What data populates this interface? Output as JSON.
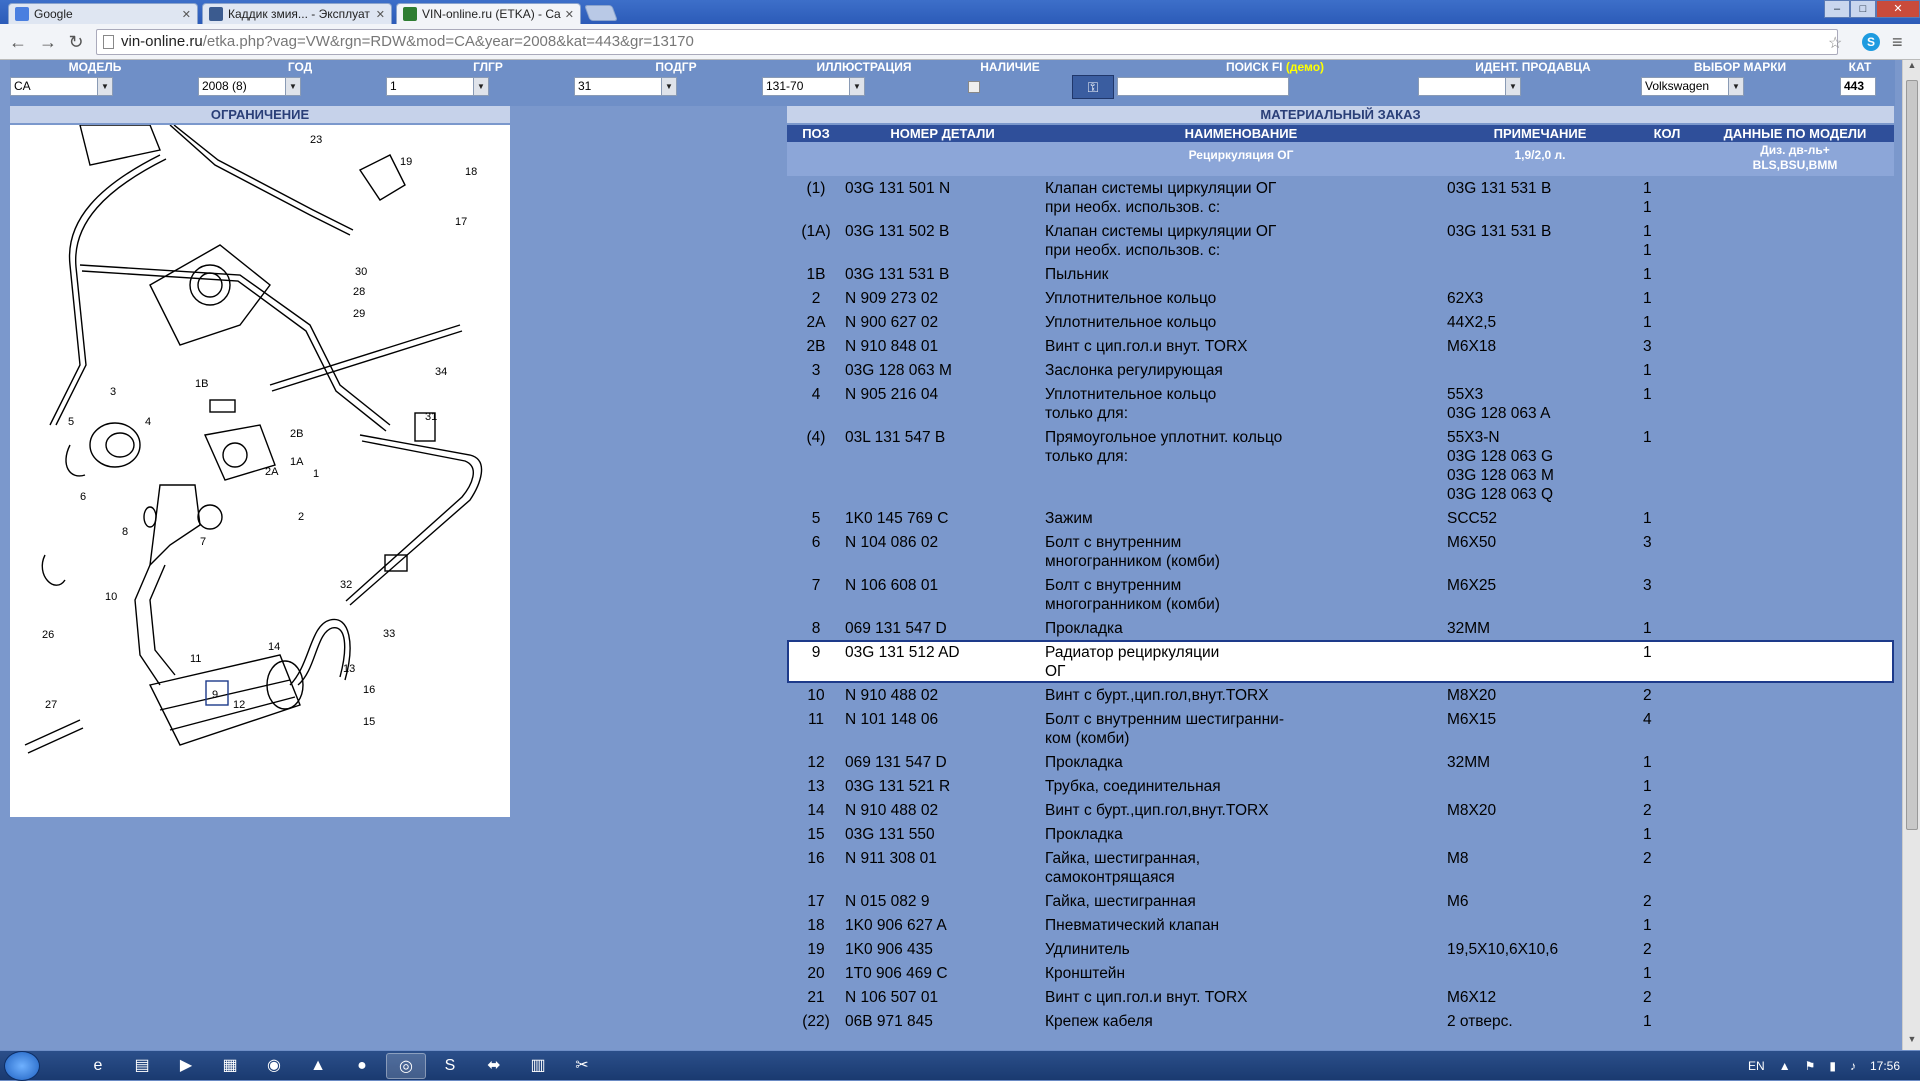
{
  "browser": {
    "tabs": [
      {
        "title": "Google",
        "favicon_color": "#4a7fe0"
      },
      {
        "title": "Каддик змия... - Эксплуат",
        "favicon_color": "#3b5b8f"
      },
      {
        "title": "VIN-online.ru (ETKA) - Cat",
        "favicon_color": "#2e7d32"
      }
    ],
    "url_host": "vin-online.ru",
    "url_path": "/etka.php?vag=VW&rgn=RDW&mod=CA&year=2008&kat=443&gr=13170"
  },
  "filters": {
    "model_label": "МОДЕЛЬ",
    "model_value": "CA",
    "year_label": "ГОД",
    "year_value": "2008 (8)",
    "group_label": "ГЛГР",
    "group_value": "1",
    "subgroup_label": "ПОДГР",
    "subgroup_value": "31",
    "illustration_label": "ИЛЛЮСТРАЦИЯ",
    "illustration_value": "131-70",
    "availability_label": "НАЛИЧИЕ",
    "search_label": "ПОИСК FI",
    "search_demo": "(демо)",
    "seller_label": "ИДЕНТ. ПРОДАВЦА",
    "brand_label": "ВЫБОР МАРКИ",
    "brand_value": "Volkswagen",
    "kat_label": "КАТ",
    "kat_value": "443"
  },
  "sections": {
    "restriction": "ОГРАНИЧЕНИЕ",
    "material_order": "МАТЕРИАЛЬНЫЙ ЗАКАЗ"
  },
  "table": {
    "headers": {
      "pos": "ПОЗ",
      "number": "НОМЕР ДЕТАЛИ",
      "name": "НАИМЕНОВАНИЕ",
      "note": "ПРИМЕЧАНИЕ",
      "qty": "КОЛ",
      "model": "ДАННЫЕ ПО МОДЕЛИ"
    },
    "subheader": {
      "name": "Рециркуляция ОГ",
      "note": "1,9/2,0 л.",
      "model_line1": "Диз. дв-ль+",
      "model_line2": "BLS,BSU,BMM"
    },
    "rows": [
      {
        "pos": "(1)",
        "number": "03G 131 501 N",
        "name": [
          "Клапан системы циркуляции ОГ",
          "при необх. использов. с:"
        ],
        "note": [
          "03G 131 531 B"
        ],
        "qty": [
          "1",
          "1"
        ]
      },
      {
        "pos": "(1A)",
        "number": "03G 131 502 B",
        "name": [
          "Клапан системы циркуляции ОГ",
          "при необх. использов. с:"
        ],
        "note": [
          "03G 131 531 B"
        ],
        "qty": [
          "1",
          "1"
        ]
      },
      {
        "pos": "1B",
        "number": "03G 131 531 B",
        "name": [
          "Пыльник"
        ],
        "note": [
          ""
        ],
        "qty": [
          "1"
        ]
      },
      {
        "pos": "2",
        "number": "N  909 273 02",
        "name": [
          "Уплотнительное кольцо"
        ],
        "note": [
          "62X3"
        ],
        "qty": [
          "1"
        ]
      },
      {
        "pos": "2A",
        "number": "N  900 627 02",
        "name": [
          "Уплотнительное кольцо"
        ],
        "note": [
          "44X2,5"
        ],
        "qty": [
          "1"
        ]
      },
      {
        "pos": "2B",
        "number": "N  910 848 01",
        "name": [
          "Винт с цип.гол.и внут. TORX"
        ],
        "note": [
          "M6X18"
        ],
        "qty": [
          "3"
        ]
      },
      {
        "pos": "3",
        "number": "03G 128 063 M",
        "name": [
          "Заслонка регулирующая"
        ],
        "note": [
          ""
        ],
        "qty": [
          "1"
        ]
      },
      {
        "pos": "4",
        "number": "N  905 216 04",
        "name": [
          "Уплотнительное кольцо",
          "только для:"
        ],
        "note": [
          "55X3",
          "03G 128 063 A"
        ],
        "qty": [
          "1"
        ]
      },
      {
        "pos": "(4)",
        "number": "03L 131 547 B",
        "name": [
          "Прямоугольное уплотнит. кольцо",
          "только для:"
        ],
        "note": [
          "55X3-N",
          "03G 128 063 G",
          "03G 128 063 M",
          "03G 128 063 Q"
        ],
        "qty": [
          "1"
        ]
      },
      {
        "pos": "5",
        "number": "1K0 145 769 C",
        "name": [
          "Зажим"
        ],
        "note": [
          "SCC52"
        ],
        "qty": [
          "1"
        ]
      },
      {
        "pos": "6",
        "number": "N  104 086 02",
        "name": [
          "Болт с внутренним",
          "многогранником (комби)"
        ],
        "note": [
          "M6X50"
        ],
        "qty": [
          "3"
        ]
      },
      {
        "pos": "7",
        "number": "N  106 608 01",
        "name": [
          "Болт с внутренним",
          "многогранником (комби)"
        ],
        "note": [
          "M6X25"
        ],
        "qty": [
          "3"
        ]
      },
      {
        "pos": "8",
        "number": "069 131 547 D",
        "name": [
          "Прокладка"
        ],
        "note": [
          "32MM"
        ],
        "qty": [
          "1"
        ]
      },
      {
        "pos": "9",
        "number": "03G 131 512 AD",
        "name": [
          "Радиатор рециркуляции",
          "ОГ"
        ],
        "note": [
          ""
        ],
        "qty": [
          "1"
        ],
        "selected": true
      },
      {
        "pos": "10",
        "number": "N  910 488 02",
        "name": [
          "Винт с бурт.,цип.гол,внут.TORX"
        ],
        "note": [
          "M8X20"
        ],
        "qty": [
          "2"
        ]
      },
      {
        "pos": "11",
        "number": "N  101 148 06",
        "name": [
          "Болт с внутренним шестигранни-",
          "ком (комби)"
        ],
        "note": [
          "M6X15"
        ],
        "qty": [
          "4"
        ]
      },
      {
        "pos": "12",
        "number": "069 131 547 D",
        "name": [
          "Прокладка"
        ],
        "note": [
          "32MM"
        ],
        "qty": [
          "1"
        ]
      },
      {
        "pos": "13",
        "number": "03G 131 521 R",
        "name": [
          "Трубка, соединительная"
        ],
        "note": [
          ""
        ],
        "qty": [
          "1"
        ]
      },
      {
        "pos": "14",
        "number": "N  910 488 02",
        "name": [
          "Винт с бурт.,цип.гол,внут.TORX"
        ],
        "note": [
          "M8X20"
        ],
        "qty": [
          "2"
        ]
      },
      {
        "pos": "15",
        "number": "03G 131 550",
        "name": [
          "Прокладка"
        ],
        "note": [
          ""
        ],
        "qty": [
          "1"
        ]
      },
      {
        "pos": "16",
        "number": "N  911 308 01",
        "name": [
          "Гайка, шестигранная,",
          "самоконтрящаяся"
        ],
        "note": [
          "M8"
        ],
        "qty": [
          "2"
        ]
      },
      {
        "pos": "17",
        "number": "N  015 082 9",
        "name": [
          "Гайка, шестигранная"
        ],
        "note": [
          "M6"
        ],
        "qty": [
          "2"
        ]
      },
      {
        "pos": "18",
        "number": "1K0 906 627 A",
        "name": [
          "Пневматический клапан"
        ],
        "note": [
          ""
        ],
        "qty": [
          "1"
        ]
      },
      {
        "pos": "19",
        "number": "1K0 906 435",
        "name": [
          "Удлинитель"
        ],
        "note": [
          "19,5X10,6X10,6"
        ],
        "qty": [
          "2"
        ]
      },
      {
        "pos": "20",
        "number": "1T0 906 469 C",
        "name": [
          "Кронштейн"
        ],
        "note": [
          ""
        ],
        "qty": [
          "1"
        ]
      },
      {
        "pos": "21",
        "number": "N  106 507 01",
        "name": [
          "Винт с цип.гол.и внут. TORX"
        ],
        "note": [
          "M6X12"
        ],
        "qty": [
          "2"
        ]
      },
      {
        "pos": "(22)",
        "number": "06B 971 845",
        "name": [
          "Крепеж кабеля"
        ],
        "note": [
          "2 отверс."
        ],
        "qty": [
          "1"
        ]
      }
    ]
  },
  "diagram": {
    "callouts": [
      "23",
      "19",
      "18",
      "17",
      "30",
      "28",
      "29",
      "34",
      "31",
      "3",
      "1B",
      "2B",
      "5",
      "4",
      "1A",
      "2A",
      "1",
      "2",
      "6",
      "7",
      "8",
      "10",
      "11",
      "9",
      "12",
      "13",
      "14",
      "16",
      "15",
      "32",
      "33",
      "26",
      "27"
    ]
  },
  "taskbar": {
    "language": "EN",
    "time": "17:56"
  }
}
